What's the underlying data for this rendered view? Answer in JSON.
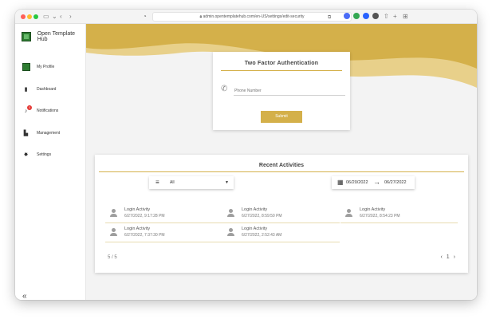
{
  "browser": {
    "url": "admin.opentemplatehub.com/en-US/settings/edit-security",
    "colors": {
      "close": "#ff5f57",
      "minimize": "#febc2e",
      "maximize": "#28c840"
    }
  },
  "sidebar": {
    "brand": "Open Template Hub",
    "items": [
      {
        "label": "My Profile",
        "icon": "avatar-icon"
      },
      {
        "label": "Dashboard",
        "icon": "clipboard-icon"
      },
      {
        "label": "Notifications",
        "icon": "bell-icon",
        "badge": "1"
      },
      {
        "label": "Management",
        "icon": "management-icon"
      },
      {
        "label": "Settings",
        "icon": "gear-icon"
      }
    ],
    "collapse_glyph": "«"
  },
  "two_factor": {
    "title": "Two Factor Authentication",
    "phone_placeholder": "Phone Number",
    "submit_label": "Submit"
  },
  "recent_activities": {
    "title": "Recent Activities",
    "filter_selected": "All",
    "date_from": "06/20/2022",
    "date_to": "06/27/2022",
    "activities": [
      {
        "title": "Login Activity",
        "date": "6/27/2022, 9:17:28 PM"
      },
      {
        "title": "Login Activity",
        "date": "6/27/2022, 8:59:50 PM"
      },
      {
        "title": "Login Activity",
        "date": "6/27/2022, 8:54:23 PM"
      },
      {
        "title": "Login Activity",
        "date": "6/27/2022, 7:37:30 PM"
      },
      {
        "title": "Login Activity",
        "date": "6/27/2022, 2:52:43 AM"
      }
    ],
    "count_label": "5 / 5",
    "page": "1"
  },
  "theme": {
    "accent": "#d4b04a",
    "wave_light": "#e8d08a"
  }
}
